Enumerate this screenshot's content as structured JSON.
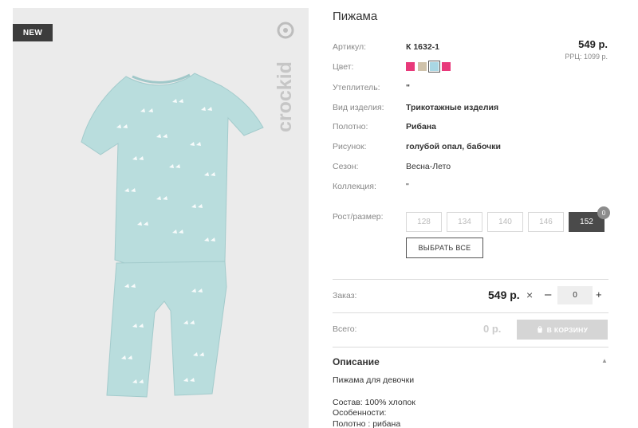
{
  "product": {
    "badge": "NEW",
    "brand": "crockid",
    "title": "Пижама",
    "price": "549 р.",
    "rrp": "РРЦ: 1099 р."
  },
  "attributes": [
    {
      "label": "Артикул:",
      "value": "К 1632-1",
      "bold": true
    },
    {
      "label": "Цвет:",
      "value": "",
      "bold": false
    },
    {
      "label": "Утеплитель:",
      "value": "\"",
      "bold": true
    },
    {
      "label": "Вид изделия:",
      "value": "Трикотажные изделия",
      "bold": true
    },
    {
      "label": "Полотно:",
      "value": "Рибана",
      "bold": true
    },
    {
      "label": "Рисунок:",
      "value": "голубой опал, бабочки",
      "bold": true
    },
    {
      "label": "Сезон:",
      "value": "Весна-Лето",
      "bold": false
    },
    {
      "label": "Коллекция:",
      "value": "\"",
      "bold": false
    }
  ],
  "colors": [
    "#e8397a",
    "#cfc2aa",
    "#a9d7e4",
    "#e8397a"
  ],
  "selected_color": 2,
  "size_label": "Рост/размер:",
  "sizes": [
    "128",
    "134",
    "140",
    "146",
    "152"
  ],
  "selected_size": "152",
  "size_count": "0",
  "select_all": "ВЫБРАТЬ ВСЕ",
  "order": {
    "label": "Заказ:",
    "price": "549 р.",
    "times": "×",
    "minus": "–",
    "qty": "0",
    "plus": "+"
  },
  "total": {
    "label": "Всего:",
    "value": "0 р.",
    "cart_button": "В КОРЗИНУ"
  },
  "description": {
    "heading": "Описание",
    "lines": [
      "Пижама для девочки",
      "Состав: 100% хлопок",
      "Особенности:",
      "Полотно : рибана"
    ]
  }
}
